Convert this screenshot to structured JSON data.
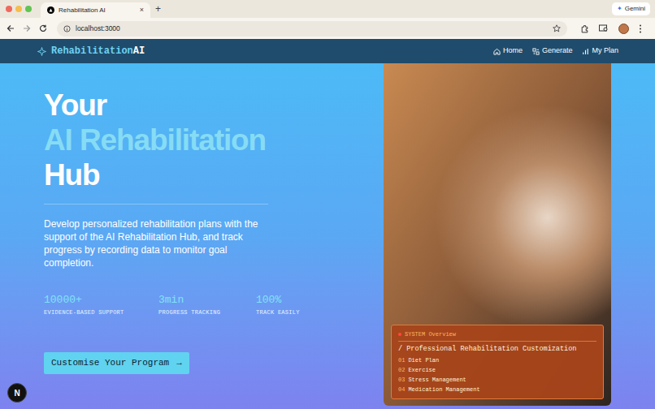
{
  "browser": {
    "tabs": [
      {
        "label": "Rehabilitation AI",
        "selected": true,
        "close": "×"
      }
    ],
    "new_tab": "+",
    "url": "localhost:3000",
    "gemini": "Gemini"
  },
  "nav": {
    "logo_primary": "Rehabilitation",
    "logo_accent": "AI",
    "items": [
      {
        "label": "Home"
      },
      {
        "label": "Generate"
      },
      {
        "label": "My Plan"
      }
    ]
  },
  "hero": {
    "title": [
      "Your",
      "AI Rehabilitation",
      "Hub"
    ],
    "description": "Develop personalized rehabilitation plans with the support of the AI Rehabilitation Hub, and track progress by recording data to monitor goal completion.",
    "stats": [
      {
        "value": "10000+",
        "label": "EVIDENCE-BASED SUPPORT"
      },
      {
        "value": "3min",
        "label": "PROGRESS TRACKING"
      },
      {
        "value": "100%",
        "label": "TRACK EASILY"
      }
    ],
    "button": "Customise Your Program",
    "button_icon": "→"
  },
  "overview": {
    "title": "SYSTEM Overview",
    "subtitle": "/ Professional Rehabilitation Customization",
    "items": [
      {
        "number": "01",
        "label": "Diet Plan"
      },
      {
        "number": "02",
        "label": "Exercise"
      },
      {
        "number": "03",
        "label": "Stress Management"
      },
      {
        "number": "04",
        "label": "Medication Management"
      }
    ]
  },
  "dev_badge": "N"
}
